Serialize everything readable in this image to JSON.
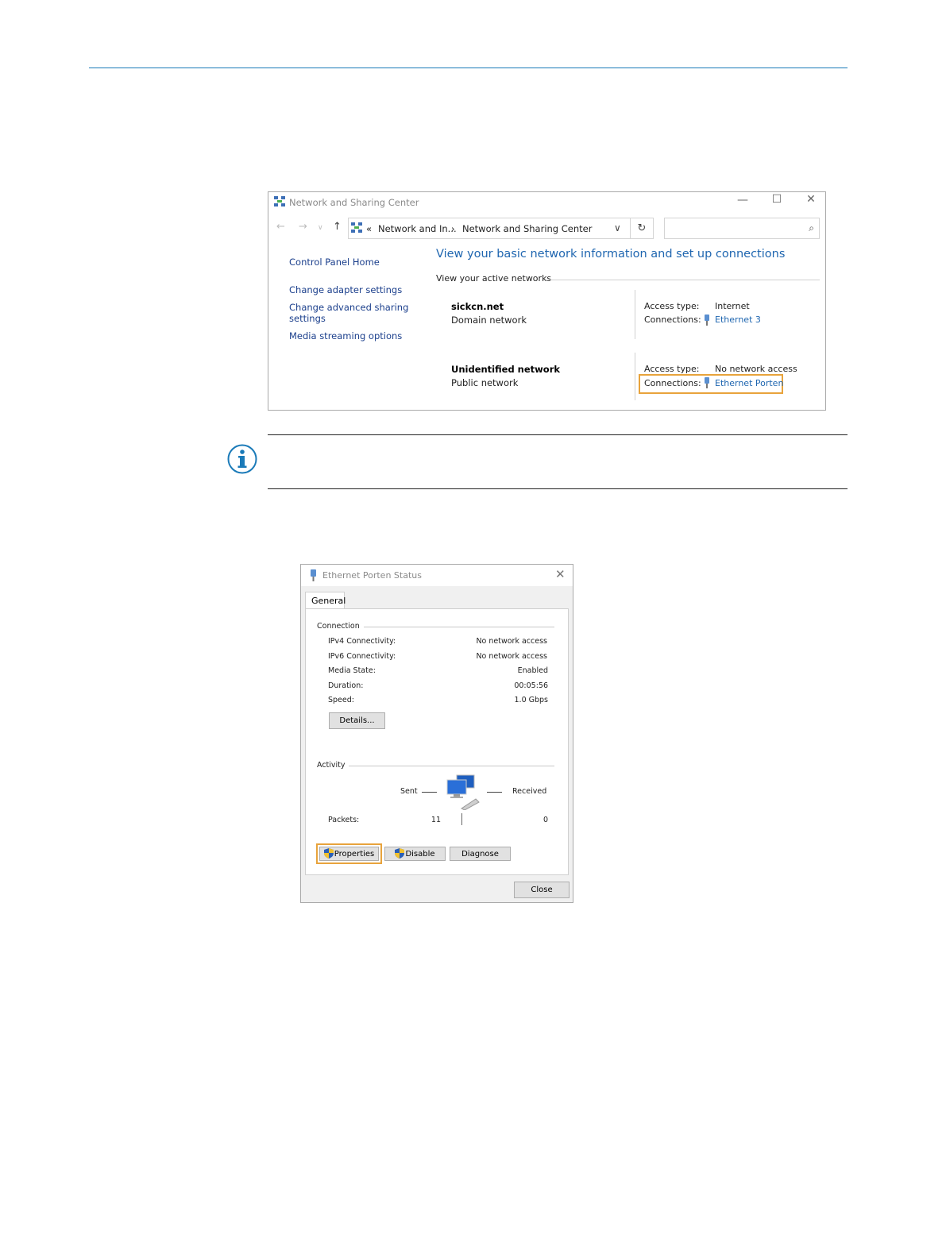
{
  "network_center": {
    "title": "Network and Sharing Center",
    "breadcrumb_prefix": "«",
    "breadcrumb_1": "Network and In...",
    "breadcrumb_sep": "›",
    "breadcrumb_2": "Network and Sharing Center",
    "sidebar": {
      "home": "Control Panel Home",
      "adapter": "Change adapter settings",
      "advanced_1": "Change advanced sharing",
      "advanced_2": "settings",
      "media": "Media streaming options"
    },
    "heading": "View your basic network information and set up connections",
    "active_networks_label": "View your active networks",
    "networks": [
      {
        "name": "sickcn.net",
        "type": "Domain network",
        "access_label": "Access type:",
        "access_value": "Internet",
        "connections_label": "Connections:",
        "connection": "Ethernet 3"
      },
      {
        "name": "Unidentified network",
        "type": "Public network",
        "access_label": "Access type:",
        "access_value": "No network access",
        "connections_label": "Connections:",
        "connection": "Ethernet Porten"
      }
    ]
  },
  "status_dialog": {
    "title": "Ethernet Porten Status",
    "tab": "General",
    "connection_label": "Connection",
    "rows": [
      {
        "label": "IPv4 Connectivity:",
        "value": "No network access"
      },
      {
        "label": "IPv6 Connectivity:",
        "value": "No network access"
      },
      {
        "label": "Media State:",
        "value": "Enabled"
      },
      {
        "label": "Duration:",
        "value": "00:05:56"
      },
      {
        "label": "Speed:",
        "value": "1.0 Gbps"
      }
    ],
    "details_button": "Details...",
    "activity_label": "Activity",
    "sent_label": "Sent",
    "received_label": "Received",
    "packets_label": "Packets:",
    "packets_sent": "11",
    "packets_received": "0",
    "properties_button": "Properties",
    "disable_button": "Disable",
    "diagnose_button": "Diagnose",
    "close_button": "Close"
  },
  "colors": {
    "link": "#1f66b0",
    "highlight": "#e8a33c",
    "rule": "#1a7ab8"
  }
}
